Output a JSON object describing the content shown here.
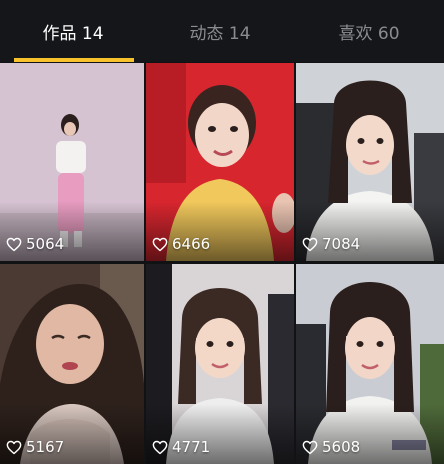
{
  "tabs": [
    {
      "label": "作品 14",
      "active": true
    },
    {
      "label": "动态 14",
      "active": false
    },
    {
      "label": "喜欢 60",
      "active": false
    }
  ],
  "accent_color": "#f7c22c",
  "videos": [
    {
      "likes": "5064"
    },
    {
      "likes": "6466"
    },
    {
      "likes": "7084"
    },
    {
      "likes": "5167"
    },
    {
      "likes": "4771"
    },
    {
      "likes": "5608"
    }
  ],
  "like_icon": "heart-outline-icon"
}
